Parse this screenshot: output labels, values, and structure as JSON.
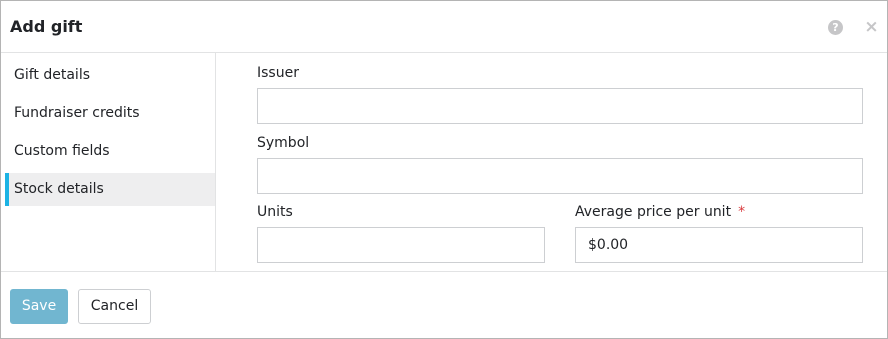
{
  "dialog": {
    "title": "Add gift",
    "help_icon_glyph": "?",
    "close_icon_glyph": "×"
  },
  "sidebar": {
    "items": [
      {
        "label": "Gift details",
        "active": false
      },
      {
        "label": "Fundraiser credits",
        "active": false
      },
      {
        "label": "Custom fields",
        "active": false
      },
      {
        "label": "Stock details",
        "active": true
      }
    ],
    "accent_color": "#1cb3e4"
  },
  "form": {
    "issuer": {
      "label": "Issuer",
      "value": ""
    },
    "symbol": {
      "label": "Symbol",
      "value": ""
    },
    "units": {
      "label": "Units",
      "value": ""
    },
    "average_price": {
      "label": "Average price per unit",
      "required_mark": "*",
      "value": "$0.00"
    }
  },
  "footer": {
    "save_label": "Save",
    "cancel_label": "Cancel",
    "primary_color": "#71b6d0"
  }
}
